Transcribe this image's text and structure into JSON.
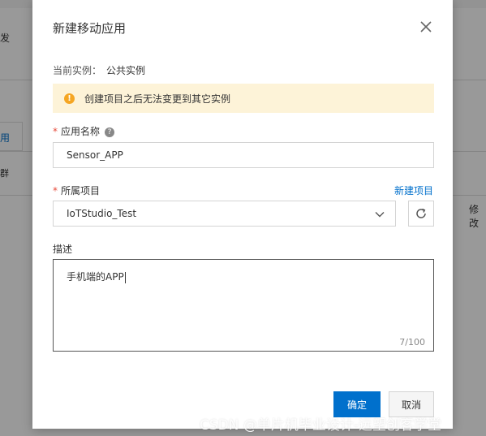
{
  "background": {
    "left_label_top": "发",
    "tab_label": "用",
    "row_label": "群",
    "right_column_header": "修改"
  },
  "dialog": {
    "title": "新建移动应用",
    "instance_label": "当前实例：",
    "instance_value": "公共实例",
    "warning_text": "创建项目之后无法变更到其它实例",
    "app_name_label": "应用名称",
    "app_name_value": "Sensor_APP",
    "project_label": "所属项目",
    "new_project_link": "新建项目",
    "project_value": "IoTStudio_Test",
    "description_label": "描述",
    "description_value": "手机端的APP",
    "char_counter": "7/100",
    "confirm_button": "确定",
    "cancel_button": "取消"
  },
  "watermark": "CSDN @单片机毕业设计-远望创客学堂",
  "colors": {
    "primary": "#0070cc",
    "required": "#e74c3c",
    "warning_bg": "#fdf3d8",
    "warning_icon": "#f5a623"
  },
  "icons": [
    "close-icon",
    "warning-icon",
    "help-icon",
    "chevron-down-icon",
    "refresh-icon"
  ]
}
